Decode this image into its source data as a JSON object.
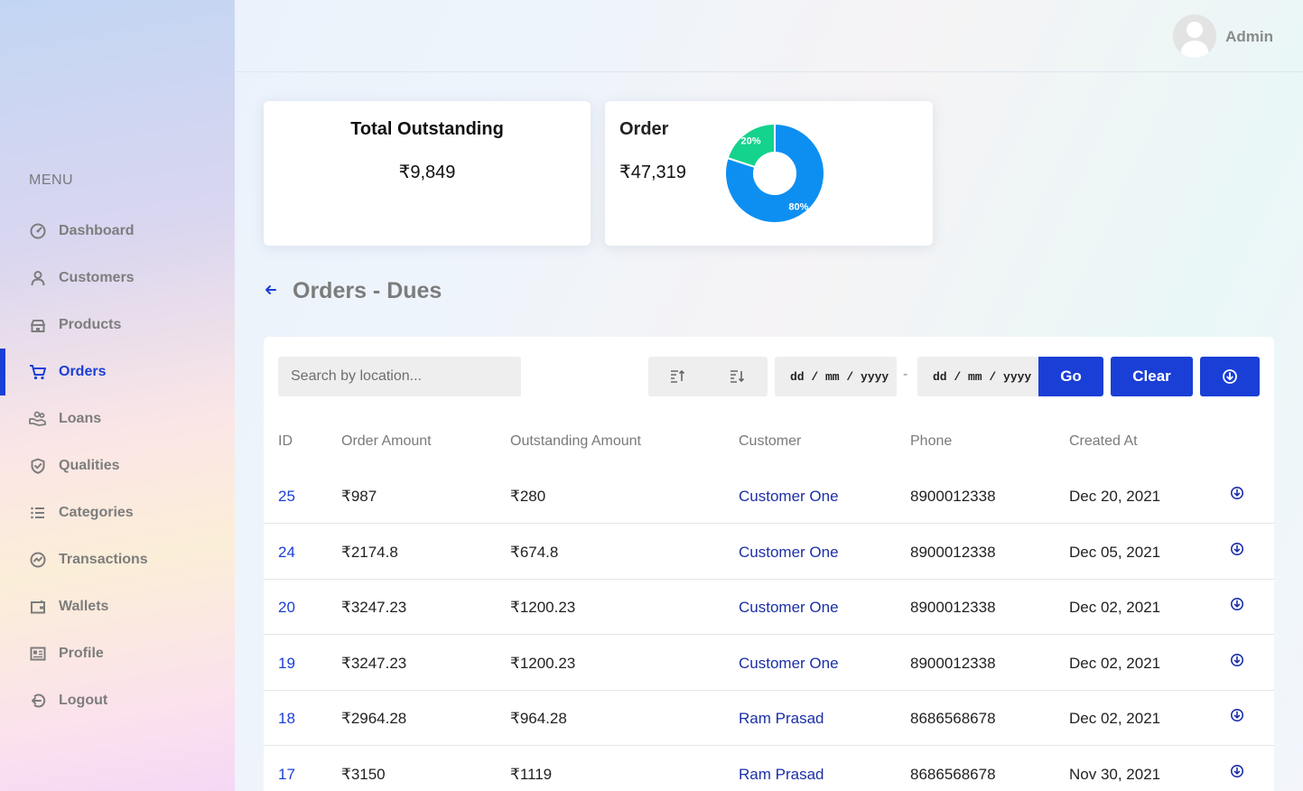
{
  "sidebar": {
    "menu_title": "MENU",
    "items": [
      {
        "label": "Dashboard",
        "icon": "gauge-icon"
      },
      {
        "label": "Customers",
        "icon": "user-icon"
      },
      {
        "label": "Products",
        "icon": "store-icon"
      },
      {
        "label": "Orders",
        "icon": "cart-icon",
        "active": true
      },
      {
        "label": "Loans",
        "icon": "hand-coins-icon"
      },
      {
        "label": "Qualities",
        "icon": "shield-check-icon"
      },
      {
        "label": "Categories",
        "icon": "list-icon"
      },
      {
        "label": "Transactions",
        "icon": "chart-circle-icon"
      },
      {
        "label": "Wallets",
        "icon": "wallet-icon"
      },
      {
        "label": "Profile",
        "icon": "id-card-icon"
      },
      {
        "label": "Logout",
        "icon": "logout-icon"
      }
    ]
  },
  "header": {
    "user_name": "Admin"
  },
  "cards": {
    "outstanding": {
      "title": "Total Outstanding",
      "value": "₹9,849"
    },
    "order": {
      "title": "Order",
      "value": "₹47,319"
    }
  },
  "chart_data": {
    "type": "pie",
    "labels": [
      "80%",
      "20%"
    ],
    "values": [
      80,
      20
    ],
    "colors": [
      "#0d8ff2",
      "#14d38c"
    ],
    "donut": true
  },
  "section": {
    "title": "Orders - Dues"
  },
  "toolbar": {
    "search_placeholder": "Search by location...",
    "date_from": "dd / mm / yyyy",
    "date_sep": "-",
    "date_to": "dd / mm / yyyy",
    "go_label": "Go",
    "clear_label": "Clear"
  },
  "table": {
    "headers": [
      "ID",
      "Order Amount",
      "Outstanding Amount",
      "Customer",
      "Phone",
      "Created At"
    ],
    "rows": [
      {
        "id": "25",
        "order_amount": "₹987",
        "outstanding": "₹280",
        "customer": "Customer One",
        "phone": "8900012338",
        "created": "Dec 20, 2021"
      },
      {
        "id": "24",
        "order_amount": "₹2174.8",
        "outstanding": "₹674.8",
        "customer": "Customer One",
        "phone": "8900012338",
        "created": "Dec 05, 2021"
      },
      {
        "id": "20",
        "order_amount": "₹3247.23",
        "outstanding": "₹1200.23",
        "customer": "Customer One",
        "phone": "8900012338",
        "created": "Dec 02, 2021"
      },
      {
        "id": "19",
        "order_amount": "₹3247.23",
        "outstanding": "₹1200.23",
        "customer": "Customer One",
        "phone": "8900012338",
        "created": "Dec 02, 2021"
      },
      {
        "id": "18",
        "order_amount": "₹2964.28",
        "outstanding": "₹964.28",
        "customer": "Ram Prasad",
        "phone": "8686568678",
        "created": "Dec 02, 2021"
      },
      {
        "id": "17",
        "order_amount": "₹3150",
        "outstanding": "₹1119",
        "customer": "Ram Prasad",
        "phone": "8686568678",
        "created": "Nov 30, 2021"
      }
    ]
  }
}
